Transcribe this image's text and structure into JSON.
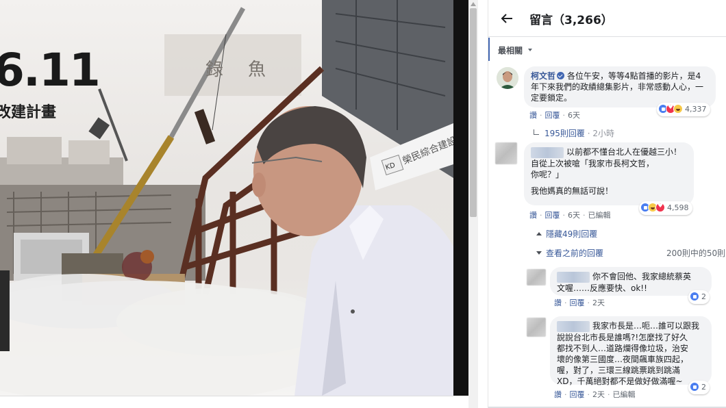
{
  "media": {
    "date_text": "6.11",
    "subtitle_text": "改建計畫",
    "sign_left": "錄",
    "sign_right": "魚",
    "banner_text": "榮民綜合建設",
    "banner_logo": "KD"
  },
  "header": {
    "back_icon": "arrow-left-icon",
    "title": "留言（3,266）"
  },
  "sort": {
    "label": "最相關"
  },
  "comments": [
    {
      "author": "柯文哲",
      "text": "各位午安，等等4點首播的影片，是4年下來我們的政績總集影片，非常感動人心，一定要鎖定。",
      "actions": {
        "like": "讚",
        "reply": "回覆",
        "time": "6天"
      },
      "reaction_count": "4,337",
      "replies": {
        "label": "195則回覆",
        "time": "2小時"
      }
    },
    {
      "line1": "以前都不懂台北人在優越三小！",
      "line2": "自從上次被嗆「我家市長柯文哲，",
      "line3": "你呢？」",
      "line4": "我他媽真的無話可說！",
      "actions": {
        "like": "讚",
        "reply": "回覆",
        "time": "6天",
        "edited": "已編輯"
      },
      "reaction_count": "4,598",
      "hide_label": "隱藏49則回覆"
    }
  ],
  "previous": {
    "label": "查看之前的回覆",
    "count": "200則中的50則"
  },
  "replies": [
    {
      "line1": "你不會回他、我家總統蔡英",
      "line2": "文喔……反應要快、ok!!",
      "actions": {
        "like": "讚",
        "reply": "回覆",
        "time": "2天"
      },
      "reaction_count": "2"
    },
    {
      "line1": "我家市長是…呃…誰可以跟我",
      "line2": "說說台北市長是誰嗎?!怎麼找了好久",
      "line3": "都找不到人…道路爛得像垃圾，治安",
      "line4": "壞的像第三國度…夜間飆車族四起，",
      "line5": "喔，對了，三環三線跳票跳到跳滿",
      "line6": "XD，千萬絕對都不是做好做滿喔~",
      "actions": {
        "like": "讚",
        "reply": "回覆",
        "time": "2天",
        "edited": "已編輯"
      },
      "reaction_count": "2"
    }
  ]
}
